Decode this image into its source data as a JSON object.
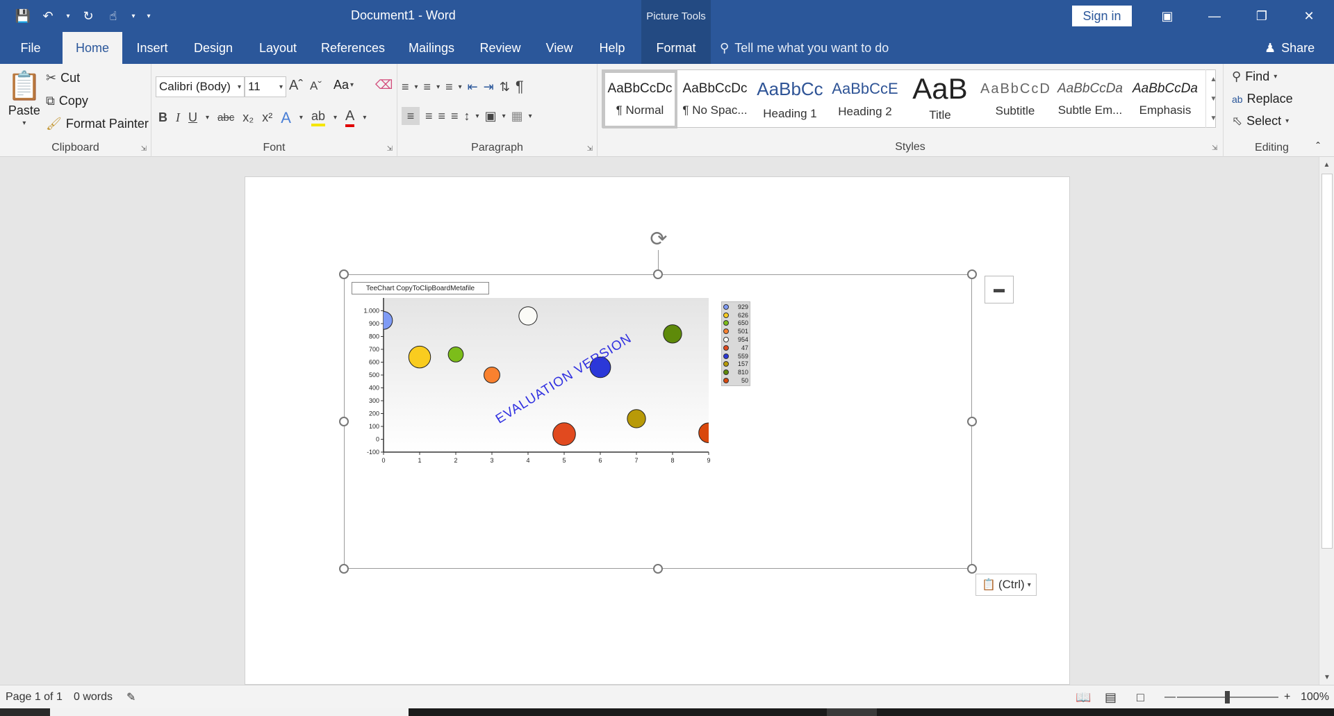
{
  "titlebar": {
    "doc_title": "Document1  -  Word",
    "picture_tools": "Picture Tools",
    "sign_in": "Sign in"
  },
  "tabs": [
    {
      "label": "File"
    },
    {
      "label": "Home"
    },
    {
      "label": "Insert"
    },
    {
      "label": "Design"
    },
    {
      "label": "Layout"
    },
    {
      "label": "References"
    },
    {
      "label": "Mailings"
    },
    {
      "label": "Review"
    },
    {
      "label": "View"
    },
    {
      "label": "Help"
    },
    {
      "label": "Format"
    }
  ],
  "tellme": "Tell me what you want to do",
  "share": "Share",
  "clipboard": {
    "paste": "Paste",
    "cut": "Cut",
    "copy": "Copy",
    "format_painter": "Format Painter",
    "label": "Clipboard"
  },
  "font": {
    "name": "Calibri (Body)",
    "size": "11",
    "change_case": "Aa",
    "label": "Font"
  },
  "paragraph": {
    "label": "Paragraph"
  },
  "styles": {
    "label": "Styles",
    "items": [
      {
        "sample": "AaBbCcDc",
        "name": "¶ Normal"
      },
      {
        "sample": "AaBbCcDc",
        "name": "¶ No Spac..."
      },
      {
        "sample": "AaBbCc",
        "name": "Heading 1"
      },
      {
        "sample": "AaBbCcE",
        "name": "Heading 2"
      },
      {
        "sample": "AaB",
        "name": "Title"
      },
      {
        "sample": "AaBbCcD",
        "name": "Subtitle"
      },
      {
        "sample": "AaBbCcDa",
        "name": "Subtle Em..."
      },
      {
        "sample": "AaBbCcDa",
        "name": "Emphasis"
      }
    ]
  },
  "editing": {
    "find": "Find",
    "replace": "Replace",
    "select": "Select",
    "label": "Editing"
  },
  "ctrl_paste": "(Ctrl)",
  "chart_data": {
    "type": "scatter",
    "title": "TeeChart CopyToClipBoardMetafile",
    "watermark": "EVALUATION VERSION",
    "xlim": [
      0,
      9
    ],
    "ylim": [
      -100,
      1100
    ],
    "x_ticks": [
      "0",
      "1",
      "2",
      "3",
      "4",
      "5",
      "6",
      "7",
      "8",
      "9"
    ],
    "y_ticks": [
      "1.000",
      "900",
      "800",
      "700",
      "600",
      "500",
      "400",
      "300",
      "200",
      "100",
      "0",
      "-100"
    ],
    "bubbles": [
      {
        "x": 0.0,
        "y": 925,
        "r": 0.45,
        "color": "#7f9bf5"
      },
      {
        "x": 1.0,
        "y": 640,
        "r": 0.55,
        "color": "#f9cc1f"
      },
      {
        "x": 2.0,
        "y": 660,
        "r": 0.38,
        "color": "#7cbd1a"
      },
      {
        "x": 3.0,
        "y": 500,
        "r": 0.4,
        "color": "#f9812f"
      },
      {
        "x": 4.0,
        "y": 960,
        "r": 0.46,
        "color": "#fbfbf7"
      },
      {
        "x": 5.0,
        "y": 40,
        "r": 0.57,
        "color": "#e14a1f"
      },
      {
        "x": 6.0,
        "y": 560,
        "r": 0.52,
        "color": "#2b38d8"
      },
      {
        "x": 7.0,
        "y": 160,
        "r": 0.46,
        "color": "#b89a08"
      },
      {
        "x": 8.0,
        "y": 820,
        "r": 0.46,
        "color": "#5e8a0a"
      },
      {
        "x": 9.0,
        "y": 50,
        "r": 0.5,
        "color": "#d9480d"
      }
    ],
    "legend": [
      {
        "label": "929",
        "color": "#7f9bf5"
      },
      {
        "label": "626",
        "color": "#f9cc1f"
      },
      {
        "label": "650",
        "color": "#7cbd1a"
      },
      {
        "label": "501",
        "color": "#f9812f"
      },
      {
        "label": "954",
        "color": "#fbfbf7"
      },
      {
        "label": "47",
        "color": "#e14a1f"
      },
      {
        "label": "559",
        "color": "#2b38d8"
      },
      {
        "label": "157",
        "color": "#b89a08"
      },
      {
        "label": "810",
        "color": "#5e8a0a"
      },
      {
        "label": "50",
        "color": "#d9480d"
      }
    ]
  },
  "status": {
    "page": "Page 1 of 1",
    "words": "0 words",
    "zoom": "100%"
  }
}
